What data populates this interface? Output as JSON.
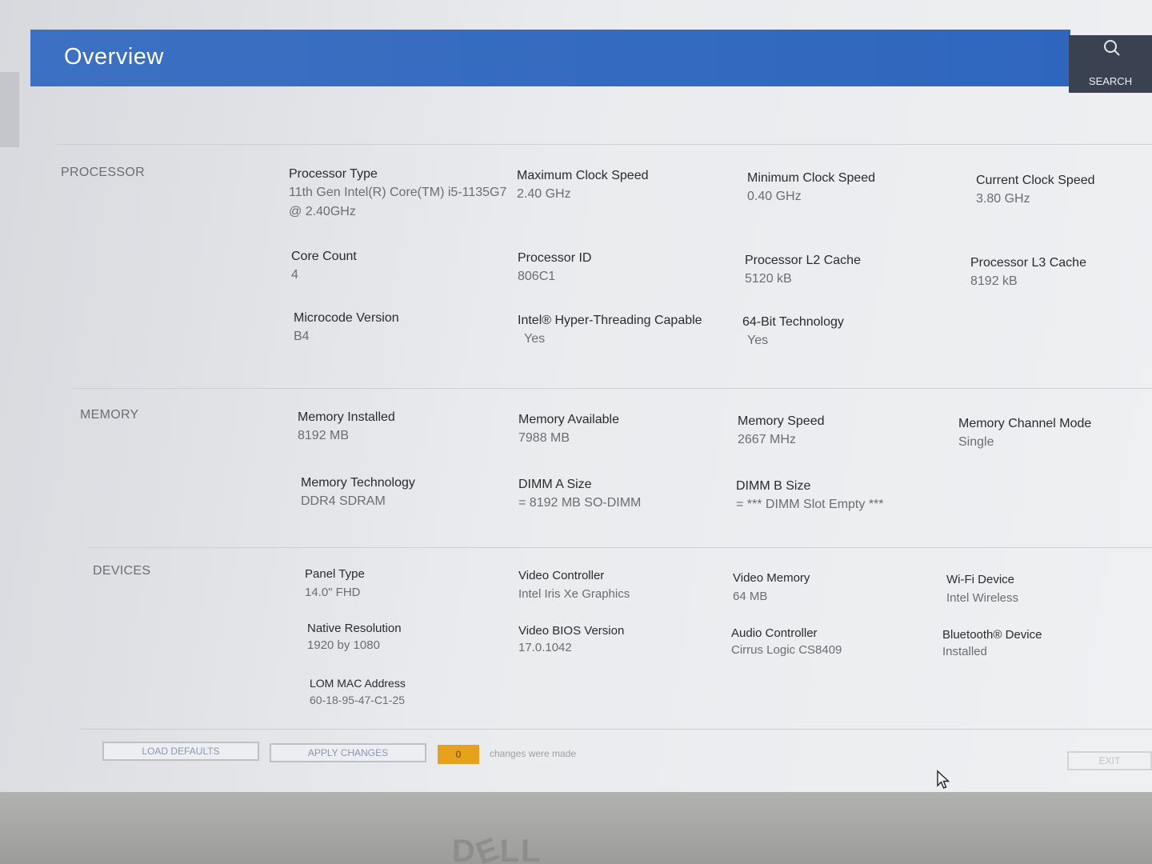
{
  "header": {
    "title": "Overview",
    "search_label": "SEARCH"
  },
  "processor": {
    "title": "PROCESSOR",
    "fields": [
      {
        "label": "Processor Type",
        "value": "11th Gen Intel(R) Core(TM) i5-1135G7 @ 2.40GHz"
      },
      {
        "label": "Maximum Clock Speed",
        "value": "2.40 GHz"
      },
      {
        "label": "Minimum Clock Speed",
        "value": "0.40 GHz"
      },
      {
        "label": "Current Clock Speed",
        "value": "3.80 GHz"
      },
      {
        "label": "Core Count",
        "value": "4"
      },
      {
        "label": "Processor ID",
        "value": "806C1"
      },
      {
        "label": "Processor L2 Cache",
        "value": "5120 kB"
      },
      {
        "label": "Processor L3 Cache",
        "value": "8192 kB"
      },
      {
        "label": "Microcode Version",
        "value": "B4"
      },
      {
        "label": "Intel® Hyper-Threading Capable",
        "value": "Yes"
      },
      {
        "label": "64-Bit Technology",
        "value": "Yes"
      }
    ]
  },
  "memory": {
    "title": "MEMORY",
    "fields": [
      {
        "label": "Memory Installed",
        "value": "8192 MB"
      },
      {
        "label": "Memory Available",
        "value": "7988 MB"
      },
      {
        "label": "Memory Speed",
        "value": "2667 MHz"
      },
      {
        "label": "Memory Channel Mode",
        "value": "Single"
      },
      {
        "label": "Memory Technology",
        "value": "DDR4 SDRAM"
      },
      {
        "label": "DIMM A Size",
        "value": "= 8192 MB SO-DIMM"
      },
      {
        "label": "DIMM B Size",
        "value": "= *** DIMM Slot Empty ***"
      }
    ]
  },
  "devices": {
    "title": "DEVICES",
    "fields": [
      {
        "label": "Panel Type",
        "value": "14.0\" FHD"
      },
      {
        "label": "Video Controller",
        "value": "Intel Iris Xe Graphics"
      },
      {
        "label": "Video Memory",
        "value": "64 MB"
      },
      {
        "label": "Wi-Fi Device",
        "value": "Intel Wireless"
      },
      {
        "label": "Native Resolution",
        "value": "1920 by 1080"
      },
      {
        "label": "Video BIOS Version",
        "value": "17.0.1042"
      },
      {
        "label": "Audio Controller",
        "value": "Cirrus Logic CS8409"
      },
      {
        "label": "Bluetooth® Device",
        "value": "Installed"
      },
      {
        "label": "LOM MAC Address",
        "value": "60-18-95-47-C1-25"
      }
    ]
  },
  "footer": {
    "load_defaults": "LOAD DEFAULTS",
    "apply_changes": "APPLY CHANGES",
    "changes_count": "0",
    "changes_text": "changes were made",
    "exit": "EXIT"
  },
  "colors": {
    "header_blue": "#3468bf",
    "search_dark": "#3a4150",
    "badge_orange": "#e6a21c"
  },
  "icons": {
    "search": "search-icon",
    "cursor": "mouse-cursor-icon"
  }
}
